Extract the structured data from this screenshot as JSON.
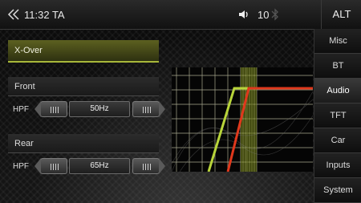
{
  "topbar": {
    "clock": "11:32 TA",
    "volume": "10",
    "alt_label": "ALT"
  },
  "xover": {
    "title": "X-Over"
  },
  "front": {
    "title": "Front",
    "filter_label": "HPF",
    "value": "50Hz"
  },
  "rear": {
    "title": "Rear",
    "filter_label": "HPF",
    "value": "65Hz"
  },
  "sidebar": {
    "items": [
      {
        "label": "Misc"
      },
      {
        "label": "BT"
      },
      {
        "label": "Audio"
      },
      {
        "label": "TFT"
      },
      {
        "label": "Car"
      },
      {
        "label": "Inputs"
      },
      {
        "label": "System"
      }
    ],
    "active": "Audio"
  },
  "colors": {
    "front_curve": "#b8d43a",
    "rear_curve": "#e0381c",
    "grid": "#d8d8b8",
    "accent": "#a8b83a"
  },
  "icons": {
    "back": "back-arrow-icon",
    "volume": "speaker-icon",
    "bluetooth": "bluetooth-icon"
  }
}
